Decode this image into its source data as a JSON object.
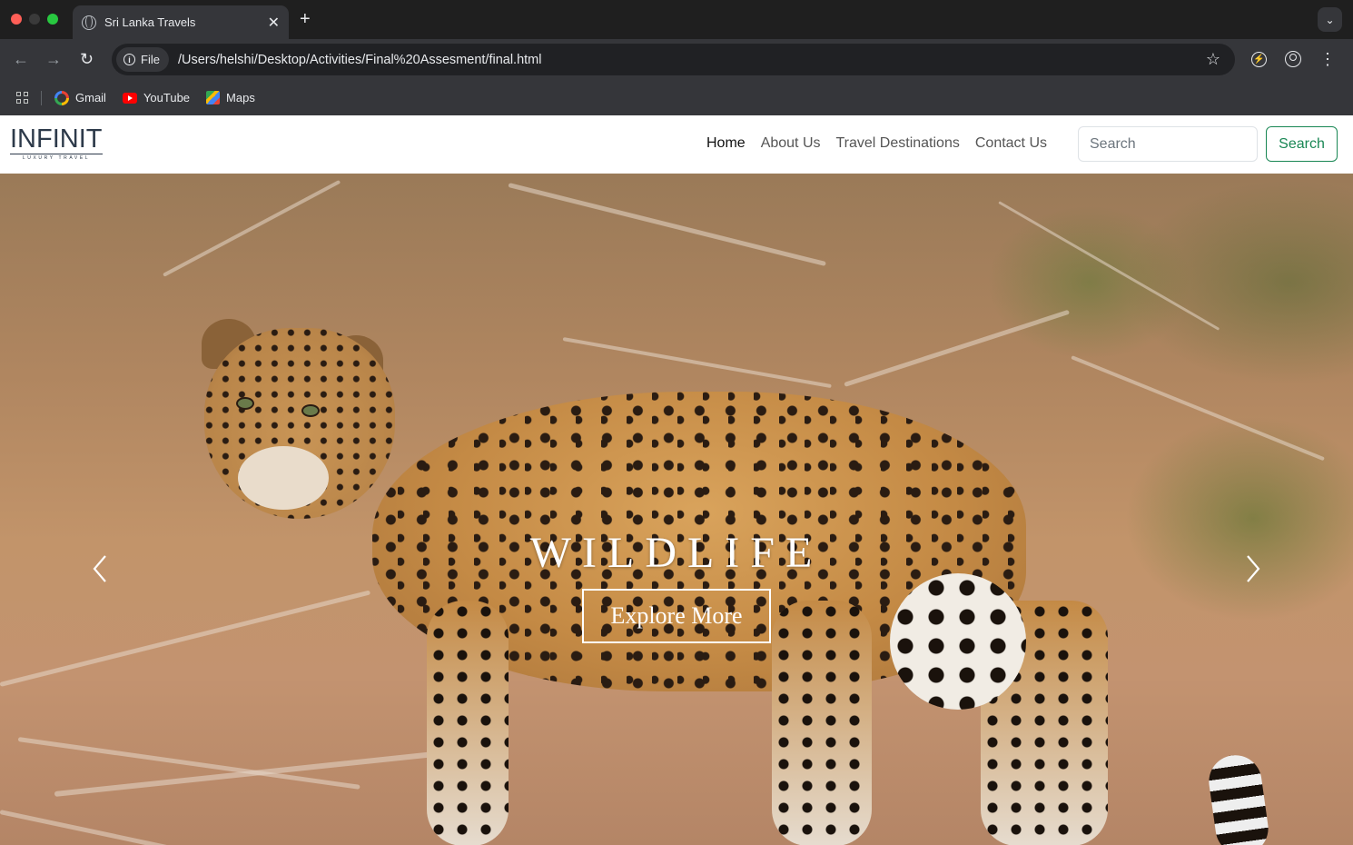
{
  "browser": {
    "tab_title": "Sri Lanka Travels",
    "url_chip": "File",
    "url": "/Users/helshi/Desktop/Activities/Final%20Assesment/final.html",
    "bookmarks": [
      {
        "label": "Gmail",
        "icon": "google-icon"
      },
      {
        "label": "YouTube",
        "icon": "youtube-icon"
      },
      {
        "label": "Maps",
        "icon": "maps-icon"
      }
    ]
  },
  "site": {
    "logo_main": "INFINIT",
    "logo_sub": "LUXURY TRAVEL",
    "nav": [
      {
        "label": "Home",
        "active": true
      },
      {
        "label": "About Us",
        "active": false
      },
      {
        "label": "Travel Destinations",
        "active": false
      },
      {
        "label": "Contact Us",
        "active": false
      }
    ],
    "search": {
      "placeholder": "Search",
      "button_label": "Search"
    },
    "accent_color": "#198754"
  },
  "hero": {
    "title": "WILDLIFE",
    "button_label": "Explore More",
    "prev_icon": "chevron-left-icon",
    "next_icon": "chevron-right-icon"
  }
}
